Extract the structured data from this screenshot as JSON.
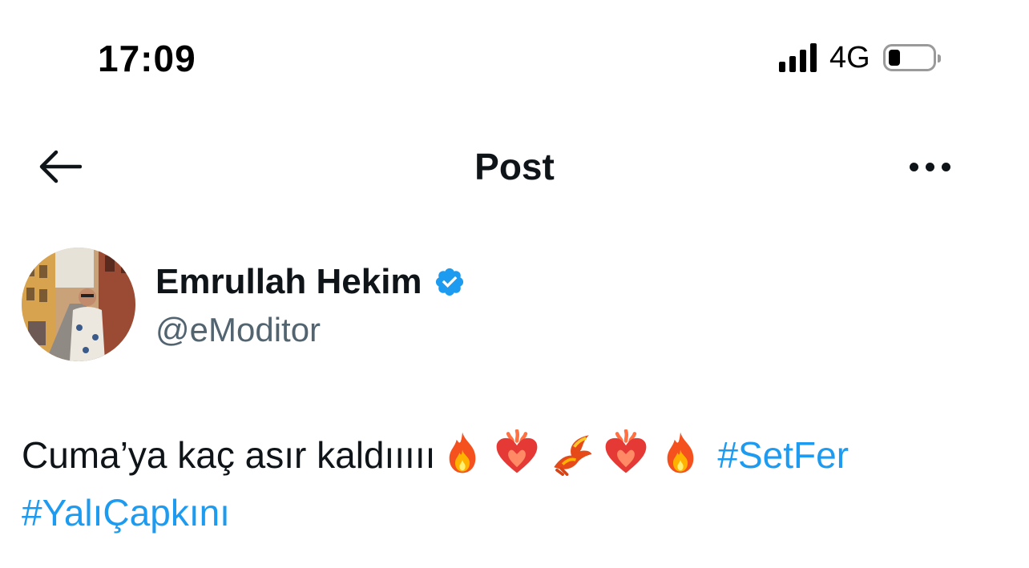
{
  "status_bar": {
    "time": "17:09",
    "network": "4G",
    "battery_level": 0.25
  },
  "header": {
    "title": "Post"
  },
  "post": {
    "author": {
      "display_name": "Emrullah Hekim",
      "handle": "@eModitor",
      "verified": true
    },
    "text": "Cuma’ya kaç asır kaldııııı",
    "emojis": [
      "fire-emoji",
      "heart-on-fire-emoji",
      "flying-phoenix-emoji",
      "heart-on-fire-emoji",
      "fire-emoji"
    ],
    "hashtags": [
      "#SetFer",
      "#YalıÇapkını"
    ]
  },
  "colors": {
    "link": "#1d9bf0",
    "text": "#0f1419",
    "secondary_text": "#536471",
    "verified_badge": "#1d9bf0"
  }
}
